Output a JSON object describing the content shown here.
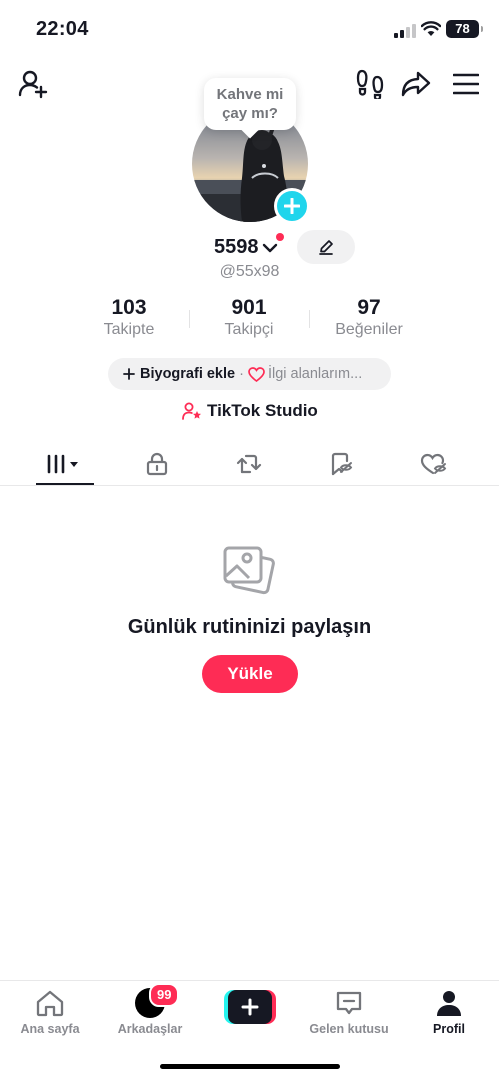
{
  "status_bar": {
    "time": "22:04",
    "battery": "78"
  },
  "header": {
    "add_friend_icon": "person-plus-icon",
    "footprints_icon": "footprints-icon",
    "share_icon": "share-arrow-icon",
    "menu_icon": "hamburger-menu-icon"
  },
  "profile": {
    "note": "Kahve mi çay mı?",
    "username": "5598",
    "handle": "@55x98",
    "stats": [
      {
        "value": "103",
        "label": "Takipte"
      },
      {
        "value": "901",
        "label": "Takipçi"
      },
      {
        "value": "97",
        "label": "Beğeniler"
      }
    ],
    "bio_button": "Biyografi ekle",
    "bio_separator": "·",
    "interests": "İlgi alanlarım...",
    "studio_label": "TikTok Studio"
  },
  "tabs": [
    {
      "icon": "grid-videos-icon",
      "active": true
    },
    {
      "icon": "lock-icon"
    },
    {
      "icon": "repost-icon"
    },
    {
      "icon": "bookmark-hidden-icon"
    },
    {
      "icon": "liked-hidden-icon"
    }
  ],
  "empty_state": {
    "icon": "photos-icon",
    "title": "Günlük rutininizi paylaşın",
    "button": "Yükle"
  },
  "bottom_nav": {
    "items": [
      {
        "label": "Ana sayfa",
        "icon": "home-icon"
      },
      {
        "label": "Arkadaşlar",
        "icon": "friends-avatar",
        "badge": "99"
      },
      {
        "label": "",
        "icon": "create-plus-icon"
      },
      {
        "label": "Gelen kutusu",
        "icon": "inbox-icon"
      },
      {
        "label": "Profil",
        "icon": "profile-icon",
        "active": true
      }
    ]
  },
  "colors": {
    "accent": "#fe2c55",
    "cyan": "#20d5ec",
    "text": "#161823",
    "muted": "#8a8b91"
  }
}
